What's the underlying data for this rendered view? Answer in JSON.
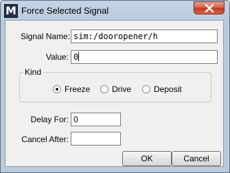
{
  "window": {
    "title": "Force Selected Signal",
    "app_icon_letter": "M"
  },
  "form": {
    "signal_name_label": "Signal Name:",
    "signal_name_value": "sim:/dooropener/h",
    "value_label": "Value:",
    "value_value": "0",
    "kind_group_label": "Kind",
    "kind_options": [
      {
        "label": "Freeze",
        "selected": true
      },
      {
        "label": "Drive",
        "selected": false
      },
      {
        "label": "Deposit",
        "selected": false
      }
    ],
    "delay_for_label": "Delay For:",
    "delay_for_value": "0",
    "cancel_after_label": "Cancel After:",
    "cancel_after_value": ""
  },
  "buttons": {
    "ok_label": "OK",
    "cancel_label": "Cancel"
  },
  "colors": {
    "title_bar": "#b9cbdd",
    "close_button": "#c94f35",
    "dialog_bg": "#f0f0f0"
  }
}
